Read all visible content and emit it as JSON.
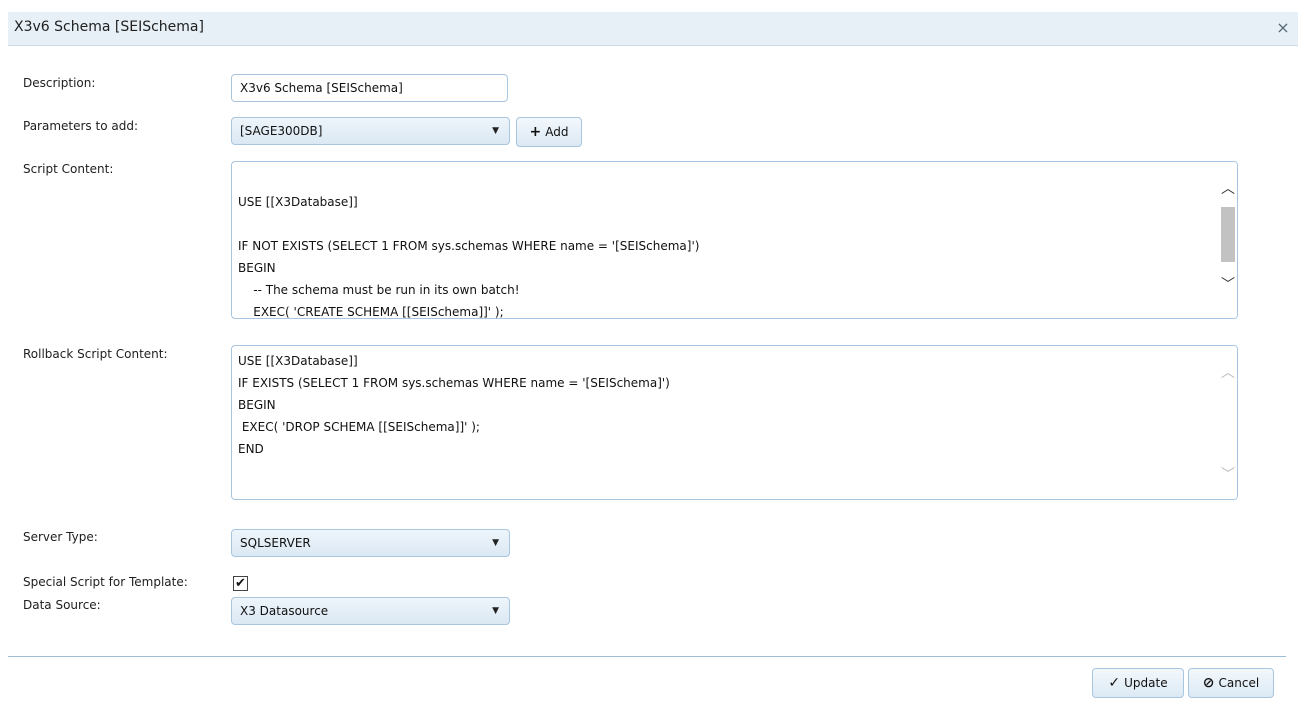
{
  "dialog": {
    "title": "X3v6 Schema [SEISchema]",
    "close_glyph": "×"
  },
  "form": {
    "description_label": "Description:",
    "description_value": "X3v6 Schema [SEISchema]",
    "parameters_label": "Parameters to add:",
    "parameters_selected": "[SAGE300DB]",
    "add_label": "Add",
    "script_label": "Script Content:",
    "script_lines": [
      "",
      "USE [[X3Database]]",
      "",
      "IF NOT EXISTS (SELECT 1 FROM sys.schemas WHERE name = '[SEISchema]')",
      "BEGIN",
      "    -- The schema must be run in its own batch!",
      "    EXEC( 'CREATE SCHEMA [[SEISchema]]' );"
    ],
    "rollback_label": "Rollback Script Content:",
    "rollback_lines": [
      "USE [[X3Database]]",
      "IF EXISTS (SELECT 1 FROM sys.schemas WHERE name = '[SEISchema]')",
      "BEGIN",
      " EXEC( 'DROP SCHEMA [[SEISchema]]' );",
      "END"
    ],
    "server_type_label": "Server Type:",
    "server_type_value": "SQLSERVER",
    "special_script_label": "Special Script for Template:",
    "special_script_checked": true,
    "data_source_label": "Data Source:",
    "data_source_value": "X3 Datasource"
  },
  "footer": {
    "update_label": "Update",
    "cancel_label": "Cancel"
  },
  "colors": {
    "titlebar_bg": "#e7f0f7",
    "border": "#a9c6e0",
    "divider": "#9cbdd6"
  }
}
